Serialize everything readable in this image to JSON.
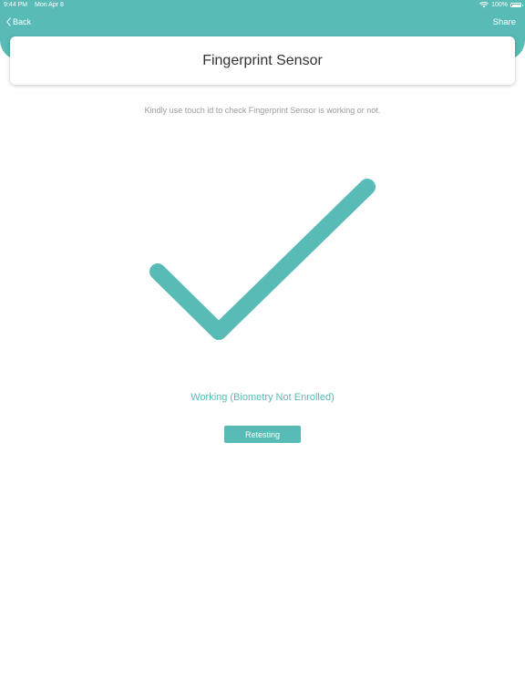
{
  "colors": {
    "accent": "#58bbb6",
    "title_text": "#333333",
    "muted_text": "#9b9b9b",
    "background": "#ffffff"
  },
  "status_bar": {
    "time": "9:44 PM",
    "date": "Mon Apr 8",
    "battery": "100%",
    "icons": [
      "wifi-icon",
      "battery-icon"
    ]
  },
  "nav": {
    "back_label": "Back",
    "back_icon": "chevron-left-icon",
    "share_label": "Share"
  },
  "header": {
    "title": "Fingerprint Sensor"
  },
  "main": {
    "instruction": "Kindly use touch id to check Fingerprint Sensor is working or not.",
    "result_icon": "checkmark-icon",
    "status": "Working (Biometry Not Enrolled)",
    "retest_label": "Retesting"
  }
}
